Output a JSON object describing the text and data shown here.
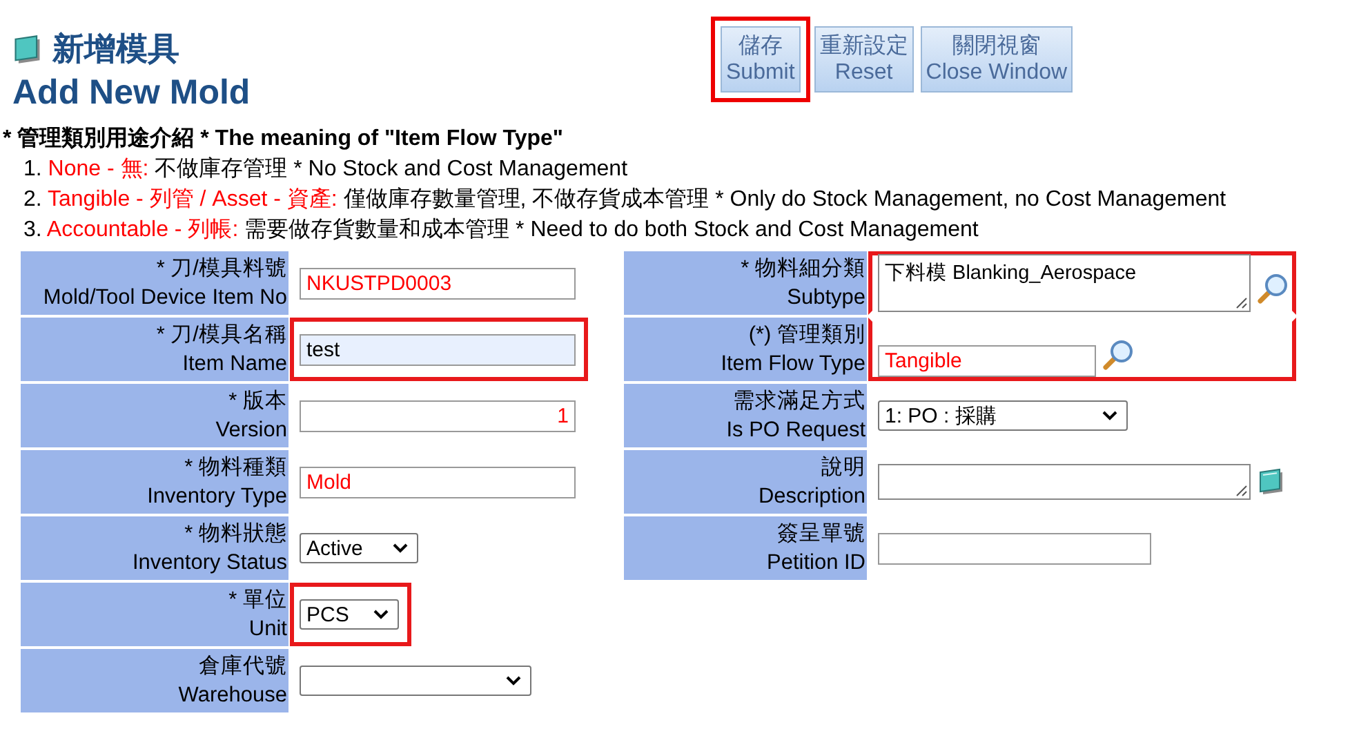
{
  "header": {
    "title_zh": "新增模具",
    "title_en": "Add New Mold"
  },
  "buttons": [
    {
      "zh": "儲存",
      "en": "Submit",
      "highlighted": true
    },
    {
      "zh": "重新設定",
      "en": "Reset",
      "highlighted": false
    },
    {
      "zh": "關閉視窗",
      "en": "Close Window",
      "highlighted": false
    }
  ],
  "legend": {
    "heading": "* 管理類別用途介紹 * The meaning of \"Item Flow Type\"",
    "items": [
      {
        "number": "1.",
        "term": "None - 無:",
        "text": "不做庫存管理 * No Stock and Cost Management"
      },
      {
        "number": "2.",
        "term": "Tangible - 列管 / Asset - 資產:",
        "text": "僅做庫存數量管理, 不做存貨成本管理 * Only do Stock Management, no Cost Management"
      },
      {
        "number": "3.",
        "term": "Accountable - 列帳:",
        "text": "需要做存貨數量和成本管理 * Need to do both Stock and Cost Management"
      }
    ]
  },
  "left_fields": [
    {
      "label_zh": "* 刀/模具料號",
      "label_en": "Mold/Tool Device Item No",
      "kind": "text",
      "value": "NKUSTPD0003",
      "emphasized": true,
      "autofilled": false,
      "highlighted": false
    },
    {
      "label_zh": "* 刀/模具名稱",
      "label_en": "Item Name",
      "kind": "text",
      "value": "test",
      "emphasized": false,
      "autofilled": true,
      "highlighted": true
    },
    {
      "label_zh": "* 版本",
      "label_en": "Version",
      "kind": "number",
      "value": "1",
      "emphasized": true,
      "autofilled": false,
      "highlighted": false
    },
    {
      "label_zh": "* 物料種類",
      "label_en": "Inventory Type",
      "kind": "text",
      "value": "Mold",
      "emphasized": true,
      "autofilled": false,
      "highlighted": false
    },
    {
      "label_zh": "* 物料狀態",
      "label_en": "Inventory Status",
      "kind": "select-small",
      "value": "Active",
      "highlighted": false
    },
    {
      "label_zh": "* 單位",
      "label_en": "Unit",
      "kind": "select-tiny",
      "value": "PCS",
      "highlighted": true
    },
    {
      "label_zh": "倉庫代號",
      "label_en": "Warehouse",
      "kind": "select-wide",
      "highlighted": false
    }
  ],
  "right_fields": [
    {
      "label_zh": "* 物料細分類",
      "label_en": "Subtype",
      "kind": "textarea-lookup",
      "value": "下料模 Blanking_Aerospace",
      "highlighted": true
    },
    {
      "label_zh": "(*) 管理類別",
      "label_en": "Item Flow Type",
      "kind": "lookup",
      "value": "Tangible",
      "emphasized": true,
      "highlighted": true
    },
    {
      "label_zh": "需求滿足方式",
      "label_en": "Is PO Request",
      "kind": "select",
      "value": "1: PO : 採購",
      "highlighted": false
    },
    {
      "label_zh": "說明",
      "label_en": "Description",
      "kind": "textarea-note",
      "highlighted": false
    },
    {
      "label_zh": "簽呈單號",
      "label_en": "Petition ID",
      "kind": "text",
      "highlighted": false
    }
  ]
}
